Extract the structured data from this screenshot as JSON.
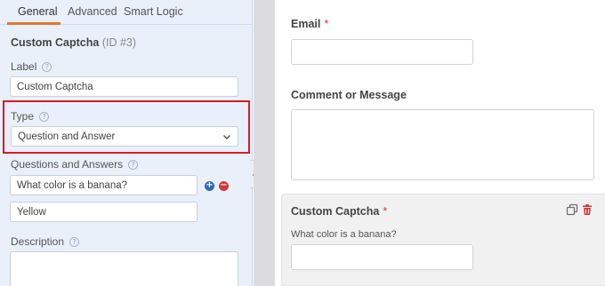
{
  "panel": {
    "tabs": [
      "General",
      "Advanced",
      "Smart Logic"
    ],
    "field_title": "Custom Captcha",
    "field_id": "(ID #3)",
    "label": {
      "title": "Label",
      "value": "Custom Captcha"
    },
    "type": {
      "title": "Type",
      "selected": "Question and Answer"
    },
    "qa": {
      "title": "Questions and Answers",
      "question": "What color is a banana?",
      "answer": "Yellow"
    },
    "description": {
      "title": "Description"
    },
    "help_glyph": "?",
    "add_glyph": "+",
    "remove_glyph": "−"
  },
  "preview": {
    "email_label": "Email",
    "comment_label": "Comment or Message",
    "captcha_label": "Custom Captcha",
    "captcha_question": "What color is a banana?",
    "required_mark": "*"
  },
  "colors": {
    "accent": "#e27730",
    "highlight": "#d81c23",
    "add": "#2e6db5",
    "remove": "#d63638",
    "panel_bg": "#e9f0fa"
  },
  "icons": [
    "help-icon",
    "chevron-down-icon",
    "add-icon",
    "remove-icon",
    "chevron-left-icon",
    "duplicate-icon",
    "trash-icon"
  ]
}
